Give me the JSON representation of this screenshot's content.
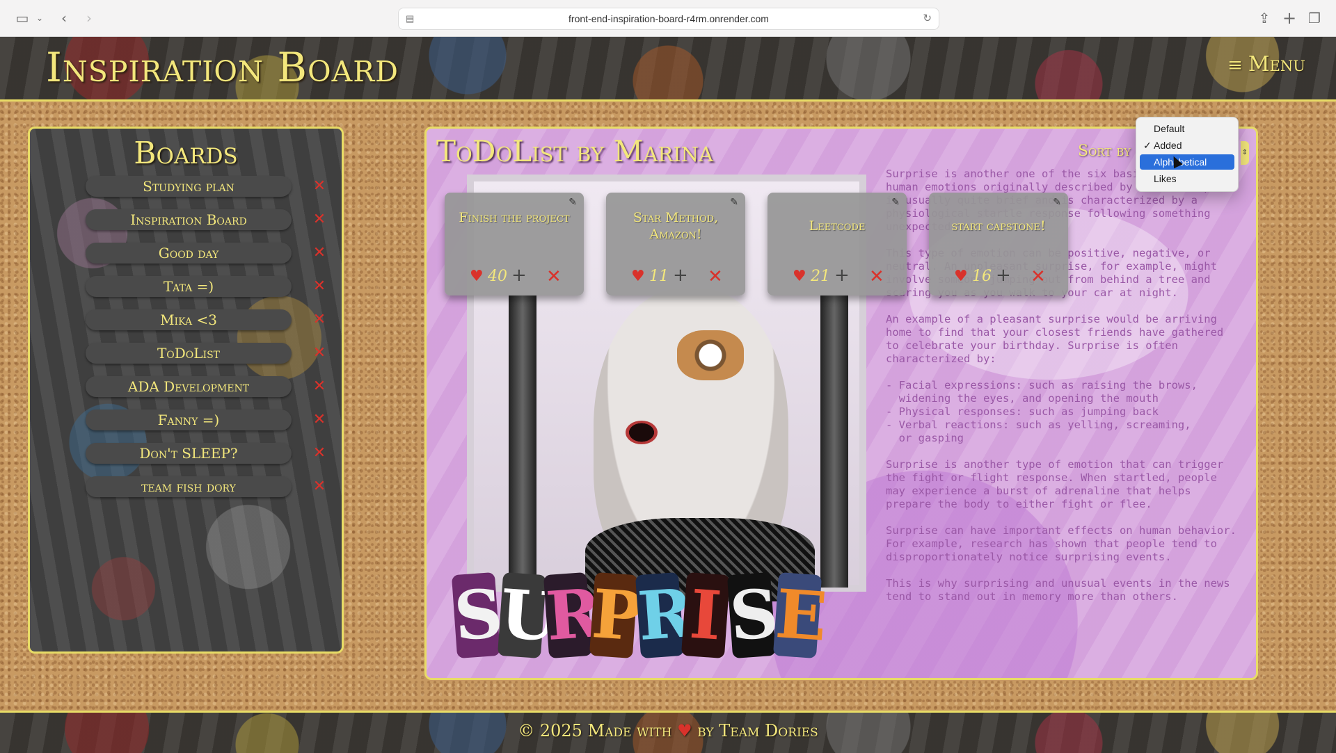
{
  "browser": {
    "url": "front-end-inspiration-board-r4rm.onrender.com"
  },
  "header": {
    "title": "Inspiration Board",
    "menu_label": "Menu"
  },
  "boards": {
    "title": "Boards",
    "items": [
      {
        "label": "Studying plan"
      },
      {
        "label": "Inspiration Board"
      },
      {
        "label": "Good day"
      },
      {
        "label": "Tata =)"
      },
      {
        "label": "Mika <3"
      },
      {
        "label": "ToDoList"
      },
      {
        "label": "ADA Development"
      },
      {
        "label": "Fanny =)"
      },
      {
        "label": "Don't SLEEP?"
      },
      {
        "label": "team fish dory"
      }
    ]
  },
  "main": {
    "board_title": "ToDoList by Marina",
    "sort_label": "Sort by",
    "sort_options": [
      "Default",
      "Added",
      "Alphabetical",
      "Likes"
    ],
    "sort_checked": "Added",
    "sort_highlighted": "Alphabetical",
    "cards": [
      {
        "message": "Finish the project",
        "likes": "40"
      },
      {
        "message": "Star Method, Amazon!",
        "likes": "11"
      },
      {
        "message": "Leetcode",
        "likes": "21"
      },
      {
        "message": "start capstone!",
        "likes": "16"
      }
    ],
    "article": [
      "Surprise is another one of the six basic types of human emotions originally described by Ekman. Surprise is usually quite brief and is characterized by a physiological startle response following something unexpected.",
      "This type of emotion can be positive, negative, or neutral. An unpleasant surprise, for example, might involve someone jumping out from behind a tree and scaring you as you walk to your car at night.",
      "An example of a pleasant surprise would be arriving home to find that your closest friends have gathered to celebrate your birthday. Surprise is often characterized by:",
      "- Facial expressions: such as raising the brows,\n  widening the eyes, and opening the mouth\n- Physical responses: such as jumping back\n- Verbal reactions: such as yelling, screaming,\n  or gasping",
      "Surprise is another type of emotion that can trigger the fight or flight response. When startled, people may experience a burst of adrenaline that helps prepare the body to either fight or flee.",
      "Surprise can have important effects on human behavior. For example, research has shown that people tend to disproportionately notice surprising events.",
      "This is why surprising and unusual events in the news tend to stand out in memory more than others."
    ],
    "art_word": "SURPRISE"
  },
  "footer": {
    "prefix": "© 2025 Made with",
    "suffix": "by Team Dories"
  },
  "colors": {
    "accent_yellow": "#f3e77c",
    "delete_red": "#d9322b",
    "selected_blue": "#2a6fdb"
  }
}
